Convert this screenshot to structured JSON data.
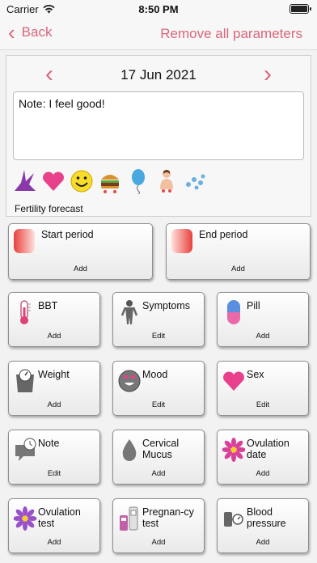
{
  "status": {
    "carrier": "Carrier",
    "time": "8:50 PM"
  },
  "nav": {
    "back_label": "Back",
    "right_label": "Remove all parameters"
  },
  "day": {
    "date": "17 Jun 2021",
    "note": "Note: I feel good!",
    "forecast": "Fertility forecast",
    "icons": [
      "fertility-symbol-icon",
      "heart-icon",
      "smiley-icon",
      "burger-icon",
      "balloon-icon",
      "person-icon",
      "drops-icon"
    ]
  },
  "period": {
    "start": {
      "title": "Start period",
      "action": "Add"
    },
    "end": {
      "title": "End period",
      "action": "Add"
    }
  },
  "params": {
    "bbt": {
      "title": "BBT",
      "action": "Add"
    },
    "symptoms": {
      "title": "Symptoms",
      "action": "Edit"
    },
    "pill": {
      "title": "Pill",
      "action": "Add"
    },
    "weight": {
      "title": "Weight",
      "action": "Add"
    },
    "mood": {
      "title": "Mood",
      "action": "Edit"
    },
    "sex": {
      "title": "Sex",
      "action": "Edit"
    },
    "note": {
      "title": "Note",
      "action": "Edit"
    },
    "cervical": {
      "title": "Cervical Mucus",
      "action": "Add"
    },
    "ovulation_date": {
      "title": "Ovulation date",
      "action": "Add"
    },
    "ovulation_test": {
      "title": "Ovulation test",
      "action": "Add"
    },
    "pregnancy_test": {
      "title": "Pregnan-cy test",
      "action": "Add"
    },
    "blood_pressure": {
      "title": "Blood pressure",
      "action": "Add"
    }
  },
  "colors": {
    "accent": "#d9667a",
    "heart": "#e8408a",
    "period_red": "#e8403a"
  }
}
